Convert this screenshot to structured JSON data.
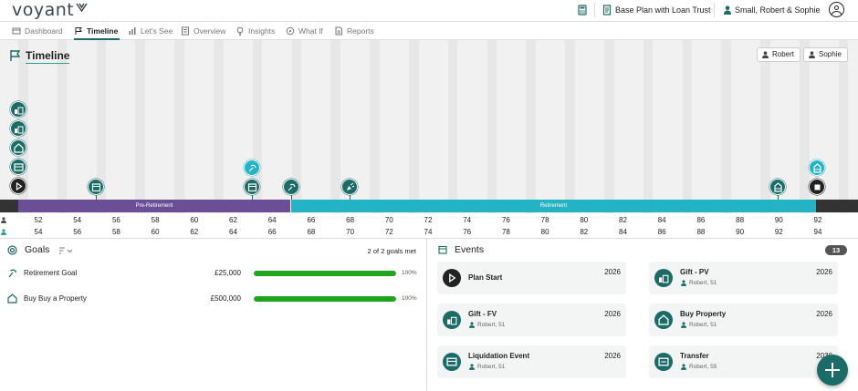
{
  "app": {
    "logo_text": "voyant",
    "logo_icon": "voyant-mark-icon"
  },
  "topbar": {
    "calculator_icon": "calculator-icon",
    "plan_icon": "document-icon",
    "plan_label": "Base Plan with Loan Trust",
    "client_icon": "person-icon",
    "client_label": "Small, Robert & Sophie",
    "account_icon": "user-circle-icon"
  },
  "nav": {
    "tabs": [
      {
        "label": "Dashboard",
        "icon": "dashboard-icon",
        "active": false
      },
      {
        "label": "Timeline",
        "icon": "flag-icon",
        "active": true
      },
      {
        "label": "Let's See",
        "icon": "bar-chart-icon",
        "active": false
      },
      {
        "label": "Overview",
        "icon": "overview-icon",
        "active": false
      },
      {
        "label": "Insights",
        "icon": "lightbulb-icon",
        "active": false
      },
      {
        "label": "What If",
        "icon": "compass-icon",
        "active": false
      },
      {
        "label": "Reports",
        "icon": "report-icon",
        "active": false
      }
    ]
  },
  "timeline": {
    "title": "Timeline",
    "people": [
      {
        "label": "Robert"
      },
      {
        "label": "Sophie"
      }
    ],
    "phases": [
      {
        "label": "Pre-Retirement",
        "color": "#6b4f96"
      },
      {
        "label": "Retirement",
        "color": "#24b3c4"
      }
    ],
    "edge_color": "#333333",
    "robert_ages": [
      "52",
      "54",
      "56",
      "58",
      "60",
      "62",
      "64",
      "66",
      "68",
      "70",
      "72",
      "74",
      "76",
      "78",
      "80",
      "82",
      "84",
      "86",
      "88",
      "90",
      "92"
    ],
    "sophie_ages": [
      "54",
      "56",
      "58",
      "60",
      "62",
      "64",
      "66",
      "68",
      "70",
      "72",
      "74",
      "76",
      "78",
      "80",
      "82",
      "84",
      "86",
      "88",
      "90",
      "92",
      "94"
    ]
  },
  "goals": {
    "title": "Goals",
    "sort_icon": "sort-icon",
    "summary": "2 of 2 goals met",
    "items": [
      {
        "name": "Retirement Goal",
        "amount": "£25,000",
        "progress": 100,
        "pct_label": "100%",
        "icon": "retirement-icon"
      },
      {
        "name": "Buy Buy a Property",
        "amount": "£500,000",
        "progress": 100,
        "pct_label": "100%",
        "icon": "house-icon"
      }
    ]
  },
  "events": {
    "title": "Events",
    "count": "13",
    "cards": [
      {
        "title": "Plan Start",
        "sub": "",
        "year": "2026",
        "icon": "play-icon"
      },
      {
        "title": "Gift - PV",
        "sub": "Robert, 51",
        "year": "2026",
        "icon": "gift-icon"
      },
      {
        "title": "Gift - FV",
        "sub": "Robert, 51",
        "year": "2026",
        "icon": "gift-icon"
      },
      {
        "title": "Buy Property",
        "sub": "Robert, 51",
        "year": "2026",
        "icon": "house-icon"
      },
      {
        "title": "Liquidation Event",
        "sub": "Robert, 51",
        "year": "2026",
        "icon": "cash-icon"
      },
      {
        "title": "Transfer",
        "sub": "Robert, 55",
        "year": "2030",
        "icon": "transfer-icon"
      }
    ],
    "add_button_icon": "plus-icon"
  }
}
